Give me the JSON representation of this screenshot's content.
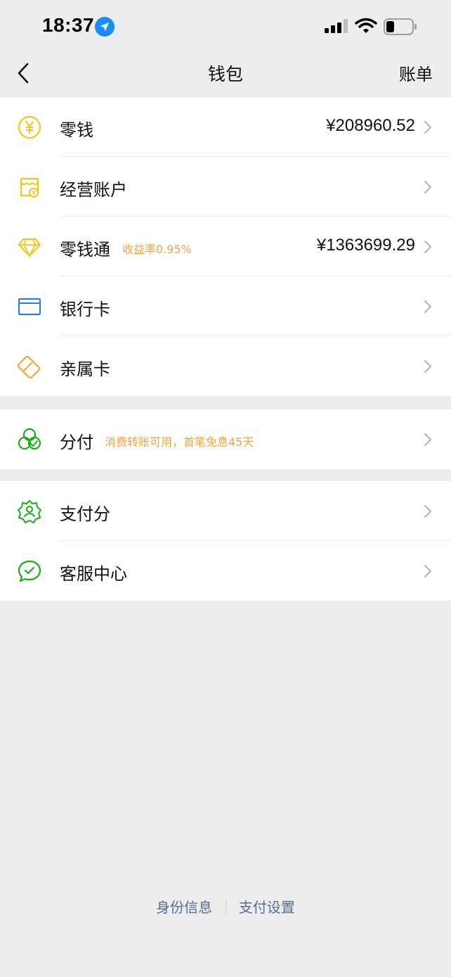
{
  "status_bar": {
    "time": "18:37",
    "icons": [
      "location-arrow-icon",
      "signal-icon",
      "wifi-icon",
      "battery-icon"
    ]
  },
  "nav": {
    "title": "钱包",
    "right_label": "账单"
  },
  "groups": [
    {
      "items": [
        {
          "name": "change",
          "icon": "yuan-coin-icon",
          "label": "零钱",
          "value": "¥208960.52"
        },
        {
          "name": "business-account",
          "icon": "shop-receipt-icon",
          "label": "经营账户"
        },
        {
          "name": "change-plus",
          "icon": "diamond-icon",
          "label": "零钱通",
          "tag": "收益率0.95%",
          "value": "¥1363699.29"
        },
        {
          "name": "bank-card",
          "icon": "bank-card-icon",
          "label": "银行卡"
        },
        {
          "name": "family-card",
          "icon": "family-card-icon",
          "label": "亲属卡"
        }
      ]
    },
    {
      "items": [
        {
          "name": "fenfu",
          "icon": "fenfu-icon",
          "label": "分付",
          "tag": "消费转账可用，首笔免息45天"
        }
      ]
    },
    {
      "items": [
        {
          "name": "pay-score",
          "icon": "pay-score-badge-icon",
          "label": "支付分"
        },
        {
          "name": "customer-service",
          "icon": "customer-service-icon",
          "label": "客服中心"
        }
      ]
    }
  ],
  "footer": {
    "identity_info": "身份信息",
    "payment_settings": "支付设置"
  },
  "colors": {
    "background": "#ededed",
    "card": "#ffffff",
    "accent_yellow": "#f5c51f",
    "tag_orange": "#f0a53c",
    "blue": "#2a7fd4",
    "green": "#1aad19",
    "link": "#576b95"
  }
}
